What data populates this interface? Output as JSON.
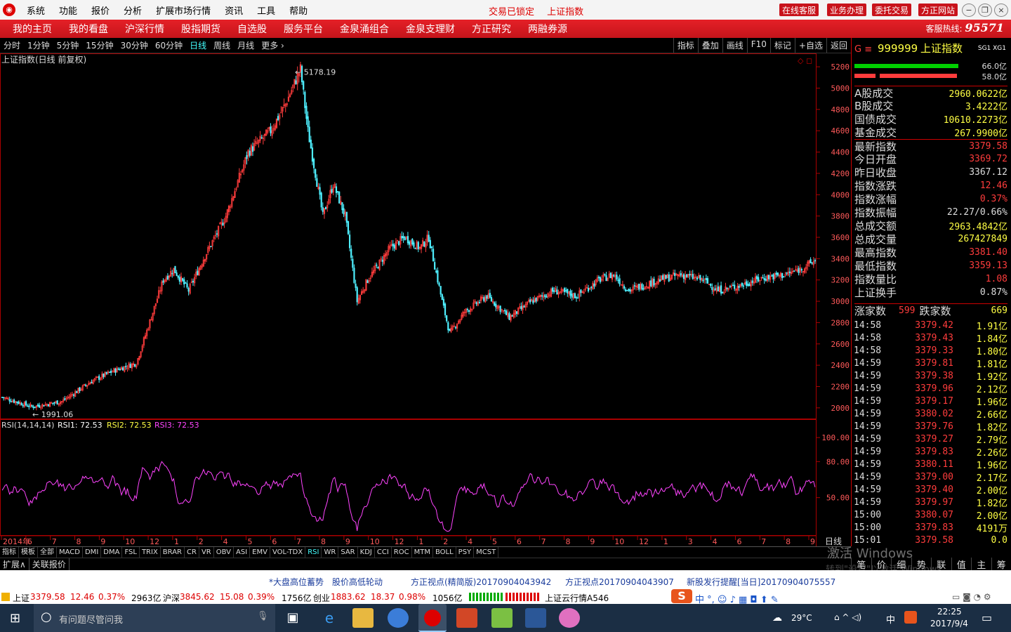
{
  "menu": {
    "items": [
      "系统",
      "功能",
      "报价",
      "分析",
      "扩展市场行情",
      "资讯",
      "工具",
      "帮助"
    ],
    "center": [
      "交易已锁定",
      "上证指数"
    ],
    "right_buttons": [
      "在线客服",
      "业务办理",
      "委托交易",
      "方正网站"
    ]
  },
  "nav": {
    "items": [
      "我的主页",
      "我的看盘",
      "沪深行情",
      "股指期货",
      "自选股",
      "服务平台",
      "金泉涌组合",
      "金泉支理财",
      "方正研究",
      "两融券源"
    ],
    "hotline_label": "客服热线:",
    "hotline_number": "95571"
  },
  "periods": {
    "items": [
      "分时",
      "1分钟",
      "5分钟",
      "15分钟",
      "30分钟",
      "60分钟",
      "日线",
      "周线",
      "月线",
      "更多 ›"
    ],
    "active": "日线",
    "tools": [
      "指标",
      "叠加",
      "画线",
      "F10",
      "标记",
      "+自选",
      "返回"
    ]
  },
  "chart_data": [
    {
      "type": "candlestick",
      "title": "上证指数(日线 前复权)",
      "y_ticks": [
        5200,
        5000,
        4800,
        4600,
        4400,
        4200,
        4000,
        3800,
        3600,
        3400,
        3200,
        3000,
        2800,
        2600,
        2400,
        2200,
        2000
      ],
      "x_ticks": [
        "2014年",
        "6",
        "7",
        "8",
        "9",
        "10",
        "12",
        "1",
        "2",
        "4",
        "5",
        "6",
        "7",
        "8",
        "9",
        "10",
        "12",
        "1",
        "2",
        "4",
        "5",
        "6",
        "7",
        "8",
        "9",
        "10",
        "12",
        "1",
        "3",
        "4",
        "6",
        "7",
        "8",
        "9"
      ],
      "x_axis_unit": "日线",
      "annotations": [
        {
          "label": "5178.19",
          "value": 5178.19
        },
        {
          "label": "1991.06",
          "value": 1991.06
        }
      ],
      "keypoints": [
        {
          "i": 0,
          "v": 2100
        },
        {
          "i": 20,
          "v": 2010
        },
        {
          "i": 40,
          "v": 2060
        },
        {
          "i": 60,
          "v": 2250
        },
        {
          "i": 75,
          "v": 2350
        },
        {
          "i": 90,
          "v": 2420
        },
        {
          "i": 108,
          "v": 3200
        },
        {
          "i": 115,
          "v": 3300
        },
        {
          "i": 125,
          "v": 3100
        },
        {
          "i": 135,
          "v": 3400
        },
        {
          "i": 150,
          "v": 3800
        },
        {
          "i": 165,
          "v": 4400
        },
        {
          "i": 180,
          "v": 4600
        },
        {
          "i": 190,
          "v": 4850
        },
        {
          "i": 200,
          "v": 5178
        },
        {
          "i": 205,
          "v": 4600
        },
        {
          "i": 215,
          "v": 3800
        },
        {
          "i": 222,
          "v": 4100
        },
        {
          "i": 230,
          "v": 3800
        },
        {
          "i": 238,
          "v": 3000
        },
        {
          "i": 245,
          "v": 3200
        },
        {
          "i": 260,
          "v": 3500
        },
        {
          "i": 270,
          "v": 3600
        },
        {
          "i": 280,
          "v": 3500
        },
        {
          "i": 286,
          "v": 3600
        },
        {
          "i": 295,
          "v": 3000
        },
        {
          "i": 300,
          "v": 2700
        },
        {
          "i": 310,
          "v": 2900
        },
        {
          "i": 325,
          "v": 3050
        },
        {
          "i": 340,
          "v": 2850
        },
        {
          "i": 355,
          "v": 3000
        },
        {
          "i": 370,
          "v": 3100
        },
        {
          "i": 385,
          "v": 3050
        },
        {
          "i": 400,
          "v": 3200
        },
        {
          "i": 410,
          "v": 3250
        },
        {
          "i": 420,
          "v": 3100
        },
        {
          "i": 440,
          "v": 3200
        },
        {
          "i": 455,
          "v": 3250
        },
        {
          "i": 470,
          "v": 3200
        },
        {
          "i": 480,
          "v": 3100
        },
        {
          "i": 495,
          "v": 3150
        },
        {
          "i": 510,
          "v": 3220
        },
        {
          "i": 525,
          "v": 3250
        },
        {
          "i": 535,
          "v": 3300
        },
        {
          "i": 545,
          "v": 3380
        }
      ]
    },
    {
      "type": "line",
      "title": "RSI(14,14,14)",
      "series": [
        {
          "name": "RSI1",
          "latest": "72.53",
          "color": "#ffffff"
        },
        {
          "name": "RSI2",
          "latest": "72.53",
          "color": "#ffff00"
        },
        {
          "name": "RSI3",
          "latest": "72.53",
          "color": "#ff44ff"
        }
      ],
      "y_ticks": [
        100,
        80,
        50
      ]
    }
  ],
  "rsi_labels": {
    "title": "RSI(14,14,14)",
    "r1": "RSI1: 72.53",
    "r2": "RSI2: 72.53",
    "r3": "RSI3: 72.53"
  },
  "quote": {
    "header_code": "999999",
    "header_name": "上证指数",
    "header_right": "SG1 XG1",
    "bar1_pct": "66.0亿",
    "bar2_pct": "58.0亿",
    "rows": [
      {
        "k": "A股成交",
        "v": "2960.0622亿",
        "c": "#ffff44"
      },
      {
        "k": "B股成交",
        "v": "3.4222亿",
        "c": "#ffff44"
      },
      {
        "k": "国债成交",
        "v": "10610.2273亿",
        "c": "#ffff44"
      },
      {
        "k": "基金成交",
        "v": "267.9900亿",
        "c": "#ffff44"
      },
      {
        "k": "最新指数",
        "v": "3379.58",
        "c": "#ff3c3c"
      },
      {
        "k": "今日开盘",
        "v": "3369.72",
        "c": "#ff3c3c"
      },
      {
        "k": "昨日收盘",
        "v": "3367.12",
        "c": "#dddddd"
      },
      {
        "k": "指数涨跌",
        "v": "12.46",
        "c": "#ff3c3c"
      },
      {
        "k": "指数涨幅",
        "v": "0.37%",
        "c": "#ff3c3c"
      },
      {
        "k": "指数振幅",
        "v": "22.27/0.66%",
        "c": "#dddddd"
      },
      {
        "k": "总成交额",
        "v": "2963.4842亿",
        "c": "#ffff44"
      },
      {
        "k": "总成交量",
        "v": "267427849",
        "c": "#ffff44"
      },
      {
        "k": "最高指数",
        "v": "3381.40",
        "c": "#ff3c3c"
      },
      {
        "k": "最低指数",
        "v": "3359.13",
        "c": "#ff3c3c"
      },
      {
        "k": "指数量比",
        "v": "1.08",
        "c": "#ff3c3c"
      },
      {
        "k": "上证换手",
        "v": "0.87%",
        "c": "#dddddd"
      }
    ],
    "up_label": "涨家数",
    "up_value": "599",
    "down_label": "跌家数",
    "down_value": "669",
    "ticks": [
      {
        "t": "14:58",
        "p": "3379.42",
        "q": "1.91亿"
      },
      {
        "t": "14:58",
        "p": "3379.43",
        "q": "1.84亿"
      },
      {
        "t": "14:58",
        "p": "3379.33",
        "q": "1.80亿"
      },
      {
        "t": "14:59",
        "p": "3379.81",
        "q": "1.81亿"
      },
      {
        "t": "14:59",
        "p": "3379.38",
        "q": "1.92亿"
      },
      {
        "t": "14:59",
        "p": "3379.96",
        "q": "2.12亿"
      },
      {
        "t": "14:59",
        "p": "3379.17",
        "q": "1.96亿"
      },
      {
        "t": "14:59",
        "p": "3380.02",
        "q": "2.66亿"
      },
      {
        "t": "14:59",
        "p": "3379.76",
        "q": "1.82亿"
      },
      {
        "t": "14:59",
        "p": "3379.27",
        "q": "2.79亿"
      },
      {
        "t": "14:59",
        "p": "3379.83",
        "q": "2.26亿"
      },
      {
        "t": "14:59",
        "p": "3380.11",
        "q": "1.96亿"
      },
      {
        "t": "14:59",
        "p": "3379.00",
        "q": "2.17亿"
      },
      {
        "t": "14:59",
        "p": "3379.40",
        "q": "2.00亿"
      },
      {
        "t": "14:59",
        "p": "3379.97",
        "q": "1.82亿"
      },
      {
        "t": "15:00",
        "p": "3380.07",
        "q": "2.00亿"
      },
      {
        "t": "15:00",
        "p": "3379.83",
        "q": "4191万"
      },
      {
        "t": "15:01",
        "p": "3379.58",
        "q": "0.0"
      }
    ],
    "bottom_tabs": [
      "笔",
      "价",
      "细",
      "势",
      "联",
      "值",
      "主",
      "筹"
    ]
  },
  "indicator_tabs": [
    "指标",
    "模板",
    "全部",
    "MACD",
    "DMI",
    "DMA",
    "FSL",
    "TRIX",
    "BRAR",
    "CR",
    "VR",
    "OBV",
    "ASI",
    "EMV",
    "VOL-TDX",
    "RSI",
    "WR",
    "SAR",
    "KDJ",
    "CCI",
    "ROC",
    "MTM",
    "BOLL",
    "PSY",
    "MCST"
  ],
  "indicator_active": "RSI",
  "ext_tabs": [
    "扩展∧",
    "关联报价"
  ],
  "news": [
    "*大盘高位蓄势",
    "股价高低轮动",
    "方正视点(精简版)20170904043942",
    "方正视点20170904043907",
    "新股发行提醒[当日]20170904075557"
  ],
  "status": {
    "sh_label": "上证",
    "sh_val": "3379.58",
    "sh_chg": "12.46",
    "sh_pct": "0.37%",
    "sh_amt": "2963亿",
    "sz_label": "沪深",
    "sz_val": "3845.62",
    "sz_chg": "15.08",
    "sz_pct": "0.39%",
    "sz_amt": "1756亿",
    "cy_label": "创业",
    "cy_val": "1883.62",
    "cy_chg": "18.37",
    "cy_pct": "0.98%",
    "cy_amt": "1056亿",
    "cloud": "上证云行情A546"
  },
  "watermark": {
    "line1": "激活 Windows",
    "line2": "转到\"设置\"以激活 Windows。"
  },
  "taskbar": {
    "search_placeholder": "有问题尽管问我",
    "temp": "29°C",
    "time": "22:25",
    "date": "2017/9/4",
    "ime": "中"
  },
  "colors": {
    "up": "#ff3c3c",
    "down": "#4ff0ff",
    "accent": "#c8131b",
    "rsi": "#ff44ff"
  }
}
